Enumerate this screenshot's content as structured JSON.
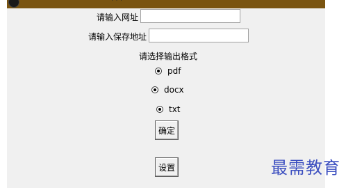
{
  "window": {
    "title_fragment": "' ' '"
  },
  "form": {
    "url_label": "请输入网址",
    "url_value": "",
    "save_label": "请输入保存地址",
    "save_value": "",
    "format_label": "请选择输出格式",
    "formats": [
      {
        "label": "pdf",
        "checked": true
      },
      {
        "label": "docx",
        "checked": true
      },
      {
        "label": "txt",
        "checked": true
      }
    ],
    "confirm_button": "确定",
    "settings_button": "设置"
  },
  "watermark": "最需教育"
}
